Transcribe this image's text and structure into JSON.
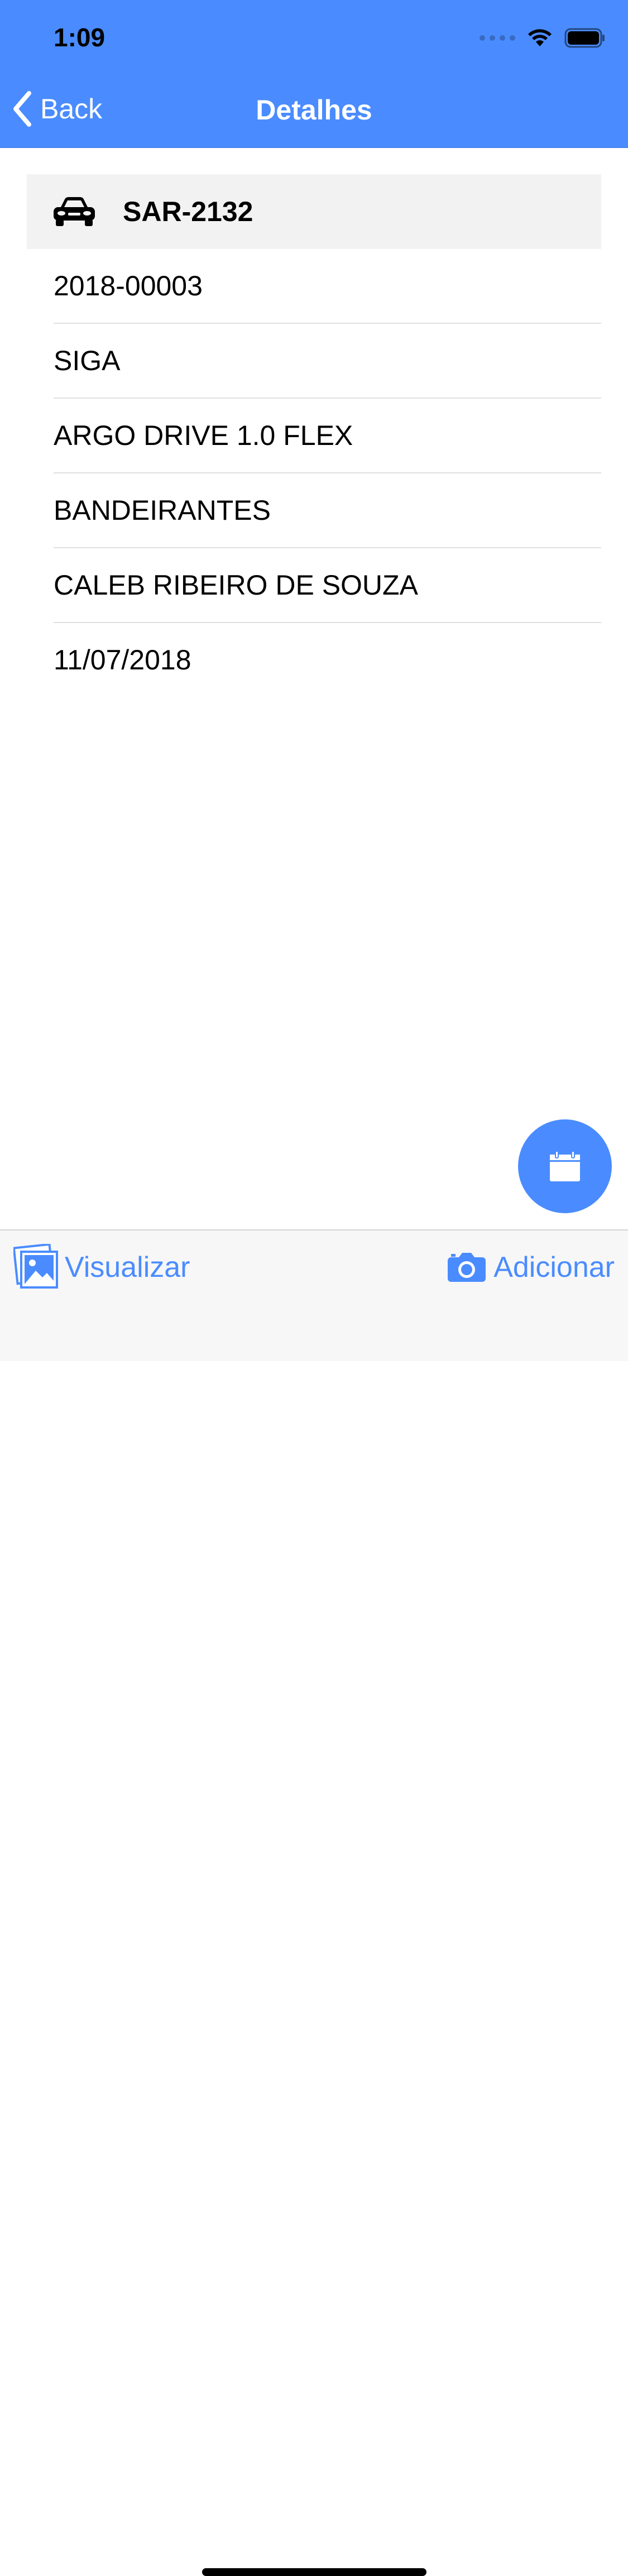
{
  "status_bar": {
    "time": "1:09"
  },
  "nav": {
    "back_label": "Back",
    "title": "Detalhes"
  },
  "vehicle": {
    "plate": "SAR-2132",
    "details": [
      "2018-00003",
      "SIGA",
      "ARGO DRIVE 1.0 FLEX",
      "BANDEIRANTES",
      "CALEB RIBEIRO DE SOUZA",
      "11/07/2018"
    ]
  },
  "toolbar": {
    "view_label": "Visualizar",
    "add_label": "Adicionar"
  },
  "colors": {
    "accent": "#4a8cff",
    "plate_row_bg": "#f2f2f2",
    "toolbar_bg": "#f7f7f7"
  },
  "icons": {
    "back": "chevron-left-icon",
    "vehicle": "car-icon",
    "fab": "calendar-icon",
    "view": "photos-icon",
    "add": "camera-icon"
  }
}
